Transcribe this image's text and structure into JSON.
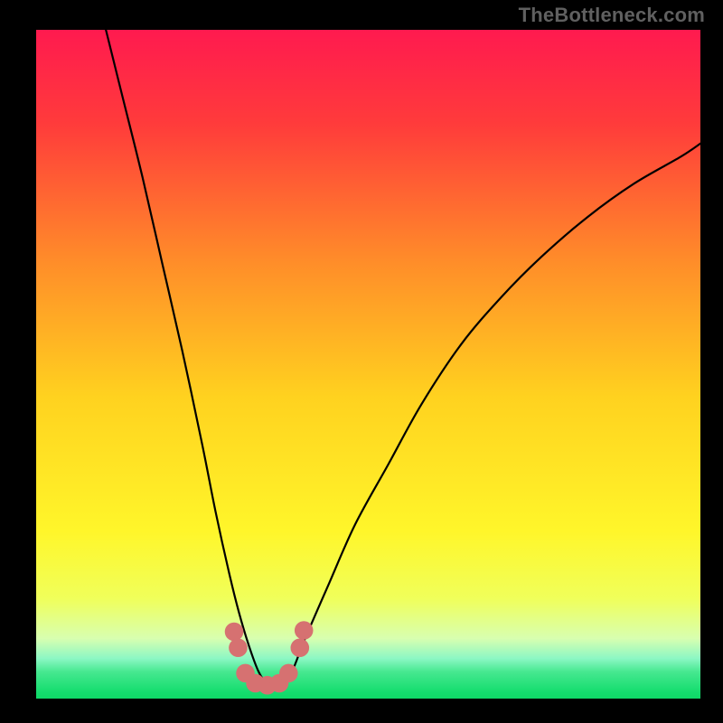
{
  "attribution": "TheBottleneck.com",
  "chart_data": {
    "type": "line",
    "title": "",
    "xlabel": "",
    "ylabel": "",
    "xlim": [
      0,
      100
    ],
    "ylim": [
      0,
      100
    ],
    "grid": false,
    "legend": false,
    "series": [
      {
        "name": "bottleneck-curve",
        "x": [
          10.5,
          13,
          16,
          19,
          22,
          25,
          27,
          29,
          30.5,
          32,
          33.5,
          35,
          37,
          38.5,
          40.5,
          44,
          48,
          53,
          58,
          64,
          70,
          76,
          83,
          90,
          97,
          100
        ],
        "y": [
          100,
          90,
          78,
          65,
          52,
          38,
          28,
          19,
          13,
          8,
          4,
          2,
          2,
          4,
          9,
          17,
          26,
          35,
          44,
          53,
          60,
          66,
          72,
          77,
          81,
          83
        ]
      }
    ],
    "markers": {
      "name": "highlighted-points",
      "color": "#d67171",
      "radius_pct": 1.4,
      "points": [
        {
          "x": 29.8,
          "y": 10.0
        },
        {
          "x": 30.4,
          "y": 7.6
        },
        {
          "x": 31.5,
          "y": 3.8
        },
        {
          "x": 33.0,
          "y": 2.3
        },
        {
          "x": 34.8,
          "y": 2.0
        },
        {
          "x": 36.6,
          "y": 2.3
        },
        {
          "x": 38.0,
          "y": 3.8
        },
        {
          "x": 39.7,
          "y": 7.6
        },
        {
          "x": 40.3,
          "y": 10.2
        }
      ]
    },
    "background_gradient": {
      "stops": [
        {
          "pct": 0,
          "color": "#ff1a4f"
        },
        {
          "pct": 14,
          "color": "#ff3b3b"
        },
        {
          "pct": 35,
          "color": "#ff8e29"
        },
        {
          "pct": 55,
          "color": "#ffd21f"
        },
        {
          "pct": 75,
          "color": "#fff62a"
        },
        {
          "pct": 85,
          "color": "#f0ff5a"
        },
        {
          "pct": 91,
          "color": "#d8ffb0"
        },
        {
          "pct": 94,
          "color": "#8cf7c4"
        },
        {
          "pct": 96,
          "color": "#46e890"
        },
        {
          "pct": 99,
          "color": "#15dd6e"
        },
        {
          "pct": 100,
          "color": "#0fd867"
        }
      ]
    }
  }
}
